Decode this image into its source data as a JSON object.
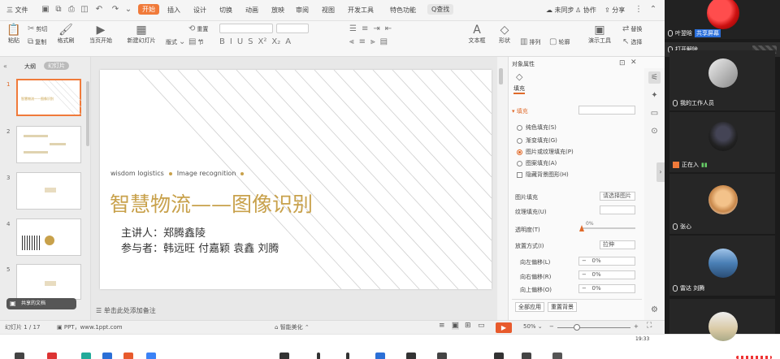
{
  "menu": {
    "file": "三 文件",
    "start": "开始",
    "tabs": [
      "插入",
      "设计",
      "切换",
      "动画",
      "放映",
      "审阅",
      "视图",
      "开发工具",
      "特色功能"
    ],
    "search": "Q查找",
    "sync": "未同步",
    "collab": "协作",
    "share": "分享"
  },
  "ribbon": {
    "cut": "剪切",
    "copy": "复制",
    "format_painter": "格式刷",
    "paste": "粘贴",
    "from_current": "当页开始",
    "new_slide": "新建幻灯片",
    "layout": "版式",
    "section": "节",
    "reset": "重置",
    "textbox": "文本框",
    "shape": "形状",
    "arrange": "排列",
    "outline": "轮廓",
    "presenter": "演示工具",
    "replace": "替换",
    "select": "选择"
  },
  "left": {
    "tab_outline": "大纲",
    "tab_slides": "幻灯片",
    "slide_numbers": [
      "1",
      "2",
      "3",
      "4",
      "5"
    ],
    "thumb_title": "智慧物流——图像识别",
    "sharing_badge": "共享的文档"
  },
  "slide": {
    "subtitle_en_1": "wisdom logistics",
    "subtitle_en_2": "Image recognition",
    "title": "智慧物流——图像识别",
    "speaker": "主讲人：郑腾鑫陵",
    "participants": "参与者：韩远旺 付嘉颖 袁鑫 刘腾",
    "notes_hint": "单击此处添加备注"
  },
  "pane": {
    "title": "对象属性",
    "tab_fill": "填充",
    "section_fill": "填充",
    "options": [
      "纯色填充(S)",
      "渐变填充(G)",
      "图片或纹理填充(P)",
      "图案填充(A)"
    ],
    "selected_option": "图片或纹理填充(P)",
    "hide_bg": "隐藏背景图形(H)",
    "picture_fill": "图片填充",
    "picture_fill_value": "请选择图片",
    "texture_fill": "纹理填充(U)",
    "transparency": "透明度(T)",
    "transparency_value": "0%",
    "placement": "放置方式(I)",
    "placement_value": "拉伸",
    "offset_left": "向左偏移(L)",
    "offset_right": "向右偏移(R)",
    "offset_up": "向上偏移(O)",
    "offset_value": "0%",
    "apply_all": "全部应用",
    "reset_bg": "重置背景"
  },
  "status": {
    "slide_count": "幻灯片 1 / 17",
    "theme": "PPT，www.1ppt.com",
    "beautify": "智能美化",
    "zoom": "50%",
    "time": "19:33"
  },
  "participants": [
    {
      "name": "叶翌晗",
      "note": "共享屏幕"
    },
    {
      "name": "打开解除",
      "note": ""
    },
    {
      "name": "我的工作人员",
      "note": ""
    },
    {
      "name": "正在入",
      "note": ""
    },
    {
      "name": "张心",
      "note": ""
    },
    {
      "name": "雷达 刘腾",
      "note": ""
    },
    {
      "name": "",
      "note": ""
    }
  ],
  "colors": {
    "accent": "#f07a3a",
    "title_gold": "#c8a14b",
    "dark_bg": "#1b1b1b"
  }
}
